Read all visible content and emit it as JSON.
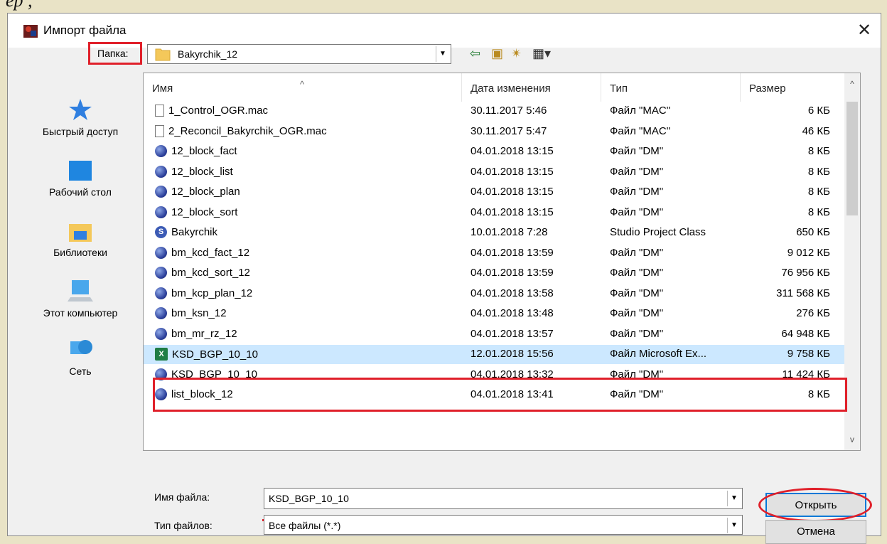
{
  "background_text": "ер        ,",
  "window": {
    "title": "Импорт файла",
    "close_glyph": "✕"
  },
  "folder_bar": {
    "label": "Папка:",
    "value": "Bakyrchik_12"
  },
  "places": [
    {
      "label": "Быстрый доступ",
      "icon": "star-icon"
    },
    {
      "label": "Рабочий стол",
      "icon": "desktop-icon"
    },
    {
      "label": "Библиотеки",
      "icon": "libraries-icon"
    },
    {
      "label": "Этот компьютер",
      "icon": "computer-icon"
    },
    {
      "label": "Сеть",
      "icon": "network-icon"
    }
  ],
  "columns": [
    "Имя",
    "Дата изменения",
    "Тип",
    "Размер"
  ],
  "files": [
    {
      "name": "1_Control_OGR.mac",
      "date": "30.11.2017 5:46",
      "type": "Файл \"MAC\"",
      "size": "6 КБ",
      "icon": "doc"
    },
    {
      "name": "2_Reconcil_Bakyrchik_OGR.mac",
      "date": "30.11.2017 5:47",
      "type": "Файл \"MAC\"",
      "size": "46 КБ",
      "icon": "doc"
    },
    {
      "name": "12_block_fact",
      "date": "04.01.2018 13:15",
      "type": "Файл \"DM\"",
      "size": "8 КБ",
      "icon": "dm"
    },
    {
      "name": "12_block_list",
      "date": "04.01.2018 13:15",
      "type": "Файл \"DM\"",
      "size": "8 КБ",
      "icon": "dm"
    },
    {
      "name": "12_block_plan",
      "date": "04.01.2018 13:15",
      "type": "Файл \"DM\"",
      "size": "8 КБ",
      "icon": "dm"
    },
    {
      "name": "12_block_sort",
      "date": "04.01.2018 13:15",
      "type": "Файл \"DM\"",
      "size": "8 КБ",
      "icon": "dm"
    },
    {
      "name": "Bakyrchik",
      "date": "10.01.2018 7:28",
      "type": "Studio Project Class",
      "size": "650 КБ",
      "icon": "proj"
    },
    {
      "name": "bm_kcd_fact_12",
      "date": "04.01.2018 13:59",
      "type": "Файл \"DM\"",
      "size": "9 012 КБ",
      "icon": "dm"
    },
    {
      "name": "bm_kcd_sort_12",
      "date": "04.01.2018 13:59",
      "type": "Файл \"DM\"",
      "size": "76 956 КБ",
      "icon": "dm"
    },
    {
      "name": "bm_kcp_plan_12",
      "date": "04.01.2018 13:58",
      "type": "Файл \"DM\"",
      "size": "311 568 КБ",
      "icon": "dm"
    },
    {
      "name": "bm_ksn_12",
      "date": "04.01.2018 13:48",
      "type": "Файл \"DM\"",
      "size": "276 КБ",
      "icon": "dm"
    },
    {
      "name": "bm_mr_rz_12",
      "date": "04.01.2018 13:57",
      "type": "Файл \"DM\"",
      "size": "64 948 КБ",
      "icon": "dm"
    },
    {
      "name": "KSD_BGP_10_10",
      "date": "12.01.2018 15:56",
      "type": "Файл Microsoft Ex...",
      "size": "9 758 КБ",
      "icon": "xls",
      "selected": true
    },
    {
      "name": "KSD_BGP_10_10",
      "date": "04.01.2018 13:32",
      "type": "Файл \"DM\"",
      "size": "11 424 КБ",
      "icon": "dm"
    },
    {
      "name": "list_block_12",
      "date": "04.01.2018 13:41",
      "type": "Файл \"DM\"",
      "size": "8 КБ",
      "icon": "dm"
    }
  ],
  "file_name": {
    "label": "Имя файла:",
    "value": "KSD_BGP_10_10"
  },
  "file_type": {
    "label": "Тип файлов:",
    "value": "Все файлы (*.*)"
  },
  "buttons": {
    "open": "Открыть",
    "cancel": "Отмена"
  },
  "colors": {
    "highlight": "#e0202a",
    "selection": "#cce8ff",
    "accent": "#0078d7"
  }
}
